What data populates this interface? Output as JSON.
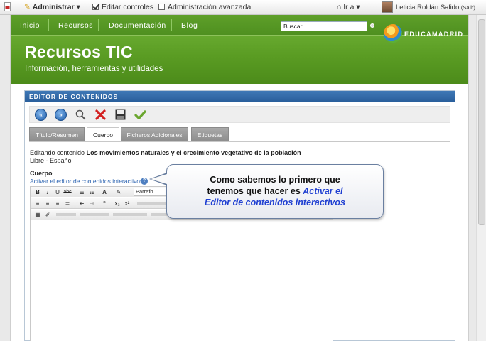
{
  "adminbar": {
    "admin_label": "Administrar",
    "edit_controls_label": "Editar controles",
    "edit_controls_checked": true,
    "advanced_admin_label": "Administración avanzada",
    "advanced_admin_checked": false,
    "goto_label": "Ir a",
    "user_name": "Leticia Roldán Salido",
    "logout_label": "(Salir)"
  },
  "nav": {
    "items": [
      "Inicio",
      "Recursos",
      "Documentación",
      "Blog"
    ],
    "search_value": "Buscar..."
  },
  "brand": {
    "logo_text": "EDUCAMADRID",
    "title": "Recursos TIC",
    "subtitle": "Información, herramientas y utilidades"
  },
  "editor": {
    "panel_title": "EDITOR DE CONTENIDOS",
    "toolbar_icons": [
      "back-icon",
      "forward-icon",
      "search-icon",
      "delete-icon",
      "save-icon",
      "publish-check-icon"
    ],
    "tabs": [
      "Título/Resumen",
      "Cuerpo",
      "Ficheros Adicionales",
      "Etiquetas"
    ],
    "active_tab": "Cuerpo",
    "editing_label": "Editando contenido",
    "content_title": "Los movimientos naturales y el crecimiento vegetativo de la población",
    "language": "Libre - Español",
    "body_label": "Cuerpo",
    "activate_link": "Activar el editor de contenidos interactivos",
    "format_select_value": "Párrafo"
  },
  "callout": {
    "line1": "Como sabemos lo primero que",
    "line2_prefix": "tenemos que hacer es ",
    "line2_highlight": "Activar el",
    "line3_highlight": "Editor de contenidos interactivos"
  },
  "colors": {
    "header_green": "#5a9c23",
    "panel_blue": "#2a5f9c",
    "link_blue": "#2a62b0",
    "callout_highlight": "#1f3fd1"
  }
}
